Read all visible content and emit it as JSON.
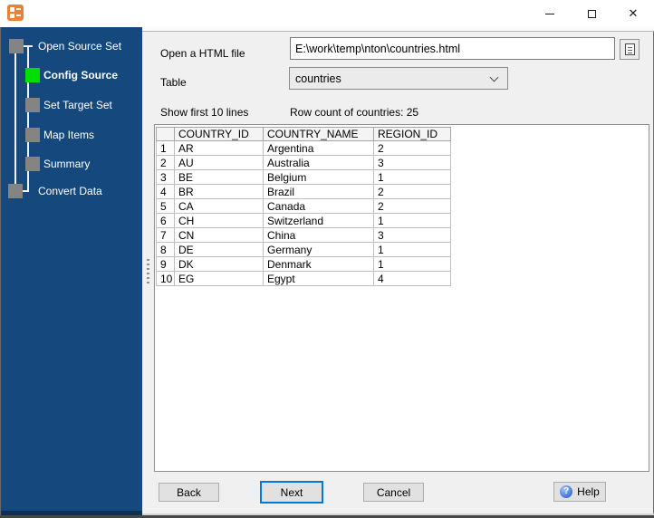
{
  "window": {
    "close_glyph": "✕"
  },
  "sidebar": {
    "steps": [
      {
        "label": "Open Source Set",
        "state": "done"
      },
      {
        "label": "Config Source",
        "state": "active"
      },
      {
        "label": "Set Target Set",
        "state": "pending"
      },
      {
        "label": "Map Items",
        "state": "pending"
      },
      {
        "label": "Summary",
        "state": "pending"
      },
      {
        "label": "Convert Data",
        "state": "pending"
      }
    ]
  },
  "form": {
    "file_label": "Open a HTML file",
    "file_value": "E:\\work\\temp\\nton\\countries.html",
    "table_label": "Table",
    "table_value": "countries",
    "show_lines_label": "Show first 10 lines",
    "row_count_label": "Row count of countries: 25"
  },
  "grid": {
    "columns": [
      "COUNTRY_ID",
      "COUNTRY_NAME",
      "REGION_ID"
    ],
    "rows": [
      [
        "1",
        "AR",
        "Argentina",
        "2"
      ],
      [
        "2",
        "AU",
        "Australia",
        "3"
      ],
      [
        "3",
        "BE",
        "Belgium",
        "1"
      ],
      [
        "4",
        "BR",
        "Brazil",
        "2"
      ],
      [
        "5",
        "CA",
        "Canada",
        "2"
      ],
      [
        "6",
        "CH",
        "Switzerland",
        "1"
      ],
      [
        "7",
        "CN",
        "China",
        "3"
      ],
      [
        "8",
        "DE",
        "Germany",
        "1"
      ],
      [
        "9",
        "DK",
        "Denmark",
        "1"
      ],
      [
        "10",
        "EG",
        "Egypt",
        "4"
      ]
    ]
  },
  "footer": {
    "back": "Back",
    "next": "Next",
    "cancel": "Cancel",
    "help": "Help",
    "help_icon": "?"
  },
  "colors": {
    "sidebar_background": "#15497e",
    "active_step_green": "#00dd00",
    "step_gray": "#848484",
    "focus_border_blue": "#0078d7",
    "help_icon_blue": "#3a6fd8",
    "app_icon_orange": "#e8823a",
    "main_background": "#f0f0f0"
  }
}
